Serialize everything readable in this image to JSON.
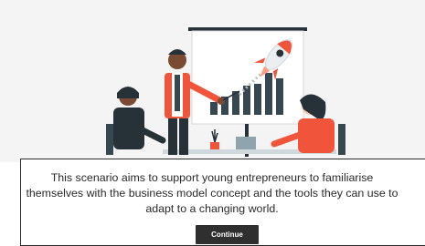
{
  "illustration": {
    "icon": "business-presentation-illustration",
    "accent": "#f0553b",
    "dark": "#263238"
  },
  "modal": {
    "text": "This scenario aims to support young entrepreneurs to familiarise themselves with the business model concept and the tools they can use to adapt to a changing world.",
    "continue_label": "Continue"
  }
}
